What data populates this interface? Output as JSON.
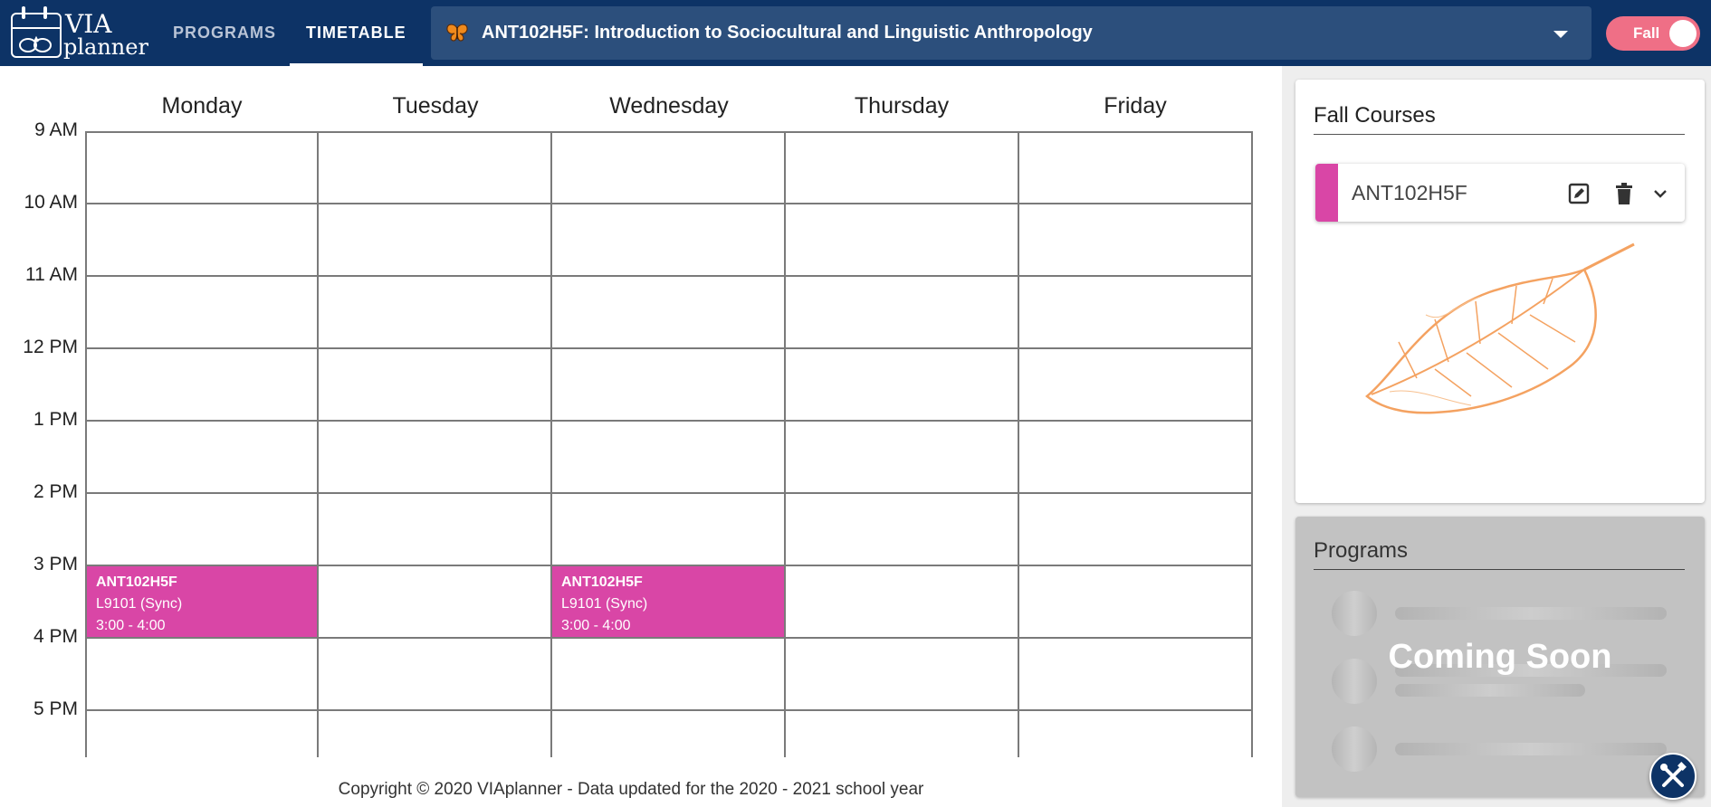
{
  "app": {
    "logo_line1": "VIA",
    "logo_line2": "planner"
  },
  "nav": {
    "tabs": [
      {
        "label": "PROGRAMS",
        "active": false
      },
      {
        "label": "TIMETABLE",
        "active": true
      }
    ]
  },
  "course_selector": {
    "icon": "butterfly-icon",
    "value": "ANT102H5F: Introduction to Sociocultural and Linguistic Anthropology"
  },
  "term_toggle": {
    "label": "Fall",
    "on": true
  },
  "timetable": {
    "days": [
      "Monday",
      "Tuesday",
      "Wednesday",
      "Thursday",
      "Friday"
    ],
    "hours": [
      "9 AM",
      "10 AM",
      "11 AM",
      "12 PM",
      "1 PM",
      "2 PM",
      "3 PM",
      "4 PM",
      "5 PM"
    ],
    "events": [
      {
        "day": "Monday",
        "code": "ANT102H5F",
        "section": "L9101 (Sync)",
        "time": "3:00 - 4:00"
      },
      {
        "day": "Wednesday",
        "code": "ANT102H5F",
        "section": "L9101 (Sync)",
        "time": "3:00 - 4:00"
      }
    ],
    "event_color": "#d946a6"
  },
  "footer": {
    "text": "Copyright © 2020 VIAplanner - Data updated for the 2020 - 2021 school year"
  },
  "sidebar": {
    "courses_title": "Fall Courses",
    "courses": [
      {
        "code": "ANT102H5F",
        "color": "#d946a6",
        "icons": [
          "edit-icon",
          "delete-icon",
          "chevron-down-icon"
        ]
      }
    ],
    "programs_title": "Programs",
    "programs_overlay": "Coming Soon"
  },
  "fab": {
    "icon": "tools-icon"
  },
  "colors": {
    "topbar": "#0d3366",
    "selector_bg": "#2c4f7c",
    "toggle": "#ef6f86",
    "leaf": "#f4a261"
  }
}
